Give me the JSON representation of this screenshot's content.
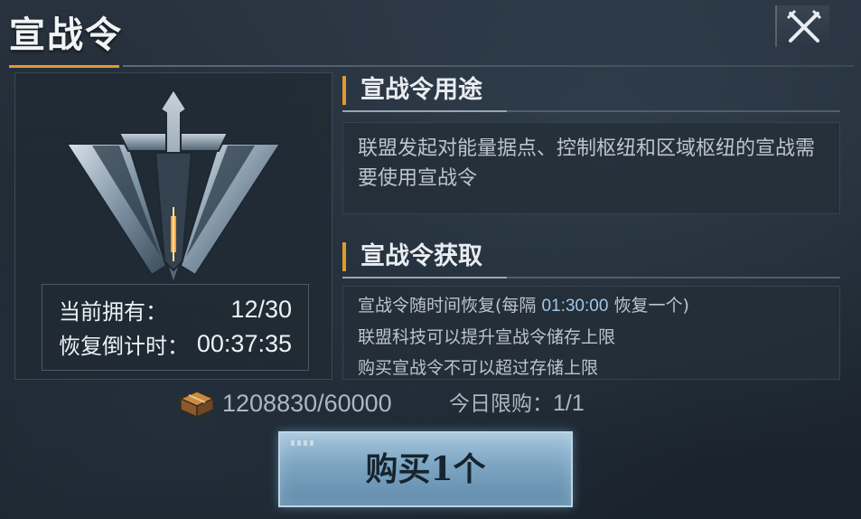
{
  "header": {
    "title": "宣战令",
    "close_icon": "close-crossed-swords-icon"
  },
  "item": {
    "emblem_icon": "war-token-emblem-icon",
    "owned_label": "当前拥有：",
    "owned_value": "12/30",
    "recover_label": "恢复倒计时：",
    "recover_value": "00:37:35"
  },
  "usage": {
    "heading": "宣战令用途",
    "text": "联盟发起对能量据点、控制枢纽和区域枢纽的宣战需要使用宣战令"
  },
  "acquire": {
    "heading": "宣战令获取",
    "line1_prefix": "宣战令随时间恢复(每隔 ",
    "line1_time": "01:30:00",
    "line1_suffix": " 恢复一个)",
    "line2": "联盟科技可以提升宣战令储存上限",
    "line3": "购买宣战令不可以超过存储上限"
  },
  "purchase": {
    "currency_icon": "resource-crate-icon",
    "currency_amount": "1208830/60000",
    "daily_limit_label": "今日限购：",
    "daily_limit_value": "1/1",
    "buy_label": "购买1个"
  },
  "colors": {
    "accent": "#e39a2b",
    "highlight_time": "#9fc7ea",
    "button": "#7ca5c2"
  }
}
